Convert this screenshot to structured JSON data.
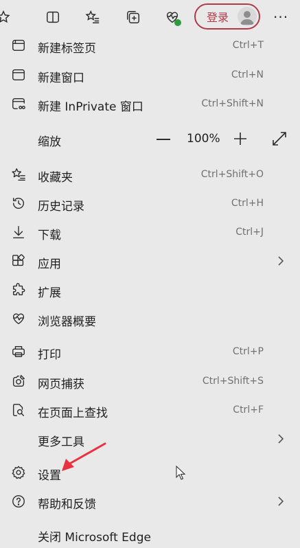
{
  "toolbar": {
    "login_label": "登录",
    "more_label": "···",
    "icons": [
      "favorite-star-icon",
      "split-screen-icon",
      "favorites-list-icon",
      "collections-add-icon",
      "browser-health-icon"
    ]
  },
  "menu": {
    "new_tab": {
      "label": "新建标签页",
      "shortcut": "Ctrl+T"
    },
    "new_window": {
      "label": "新建窗口",
      "shortcut": "Ctrl+N"
    },
    "new_inprivate": {
      "label": "新建 InPrivate 窗口",
      "shortcut": "Ctrl+Shift+N"
    },
    "zoom": {
      "label": "缩放",
      "value": "100%"
    },
    "favorites": {
      "label": "收藏夹",
      "shortcut": "Ctrl+Shift+O"
    },
    "history": {
      "label": "历史记录",
      "shortcut": "Ctrl+H"
    },
    "downloads": {
      "label": "下载",
      "shortcut": "Ctrl+J"
    },
    "apps": {
      "label": "应用"
    },
    "extensions": {
      "label": "扩展"
    },
    "browser_essentials": {
      "label": "浏览器概要"
    },
    "print": {
      "label": "打印",
      "shortcut": "Ctrl+P"
    },
    "web_capture": {
      "label": "网页捕获",
      "shortcut": "Ctrl+Shift+S"
    },
    "find": {
      "label": "在页面上查找",
      "shortcut": "Ctrl+F"
    },
    "more_tools": {
      "label": "更多工具"
    },
    "settings": {
      "label": "设置"
    },
    "help": {
      "label": "帮助和反馈"
    },
    "close": {
      "label": "关闭 Microsoft Edge"
    }
  },
  "colors": {
    "login_accent": "#b23a48",
    "annotation_arrow": "#e8323f",
    "health_badge": "#2e9b3e"
  }
}
